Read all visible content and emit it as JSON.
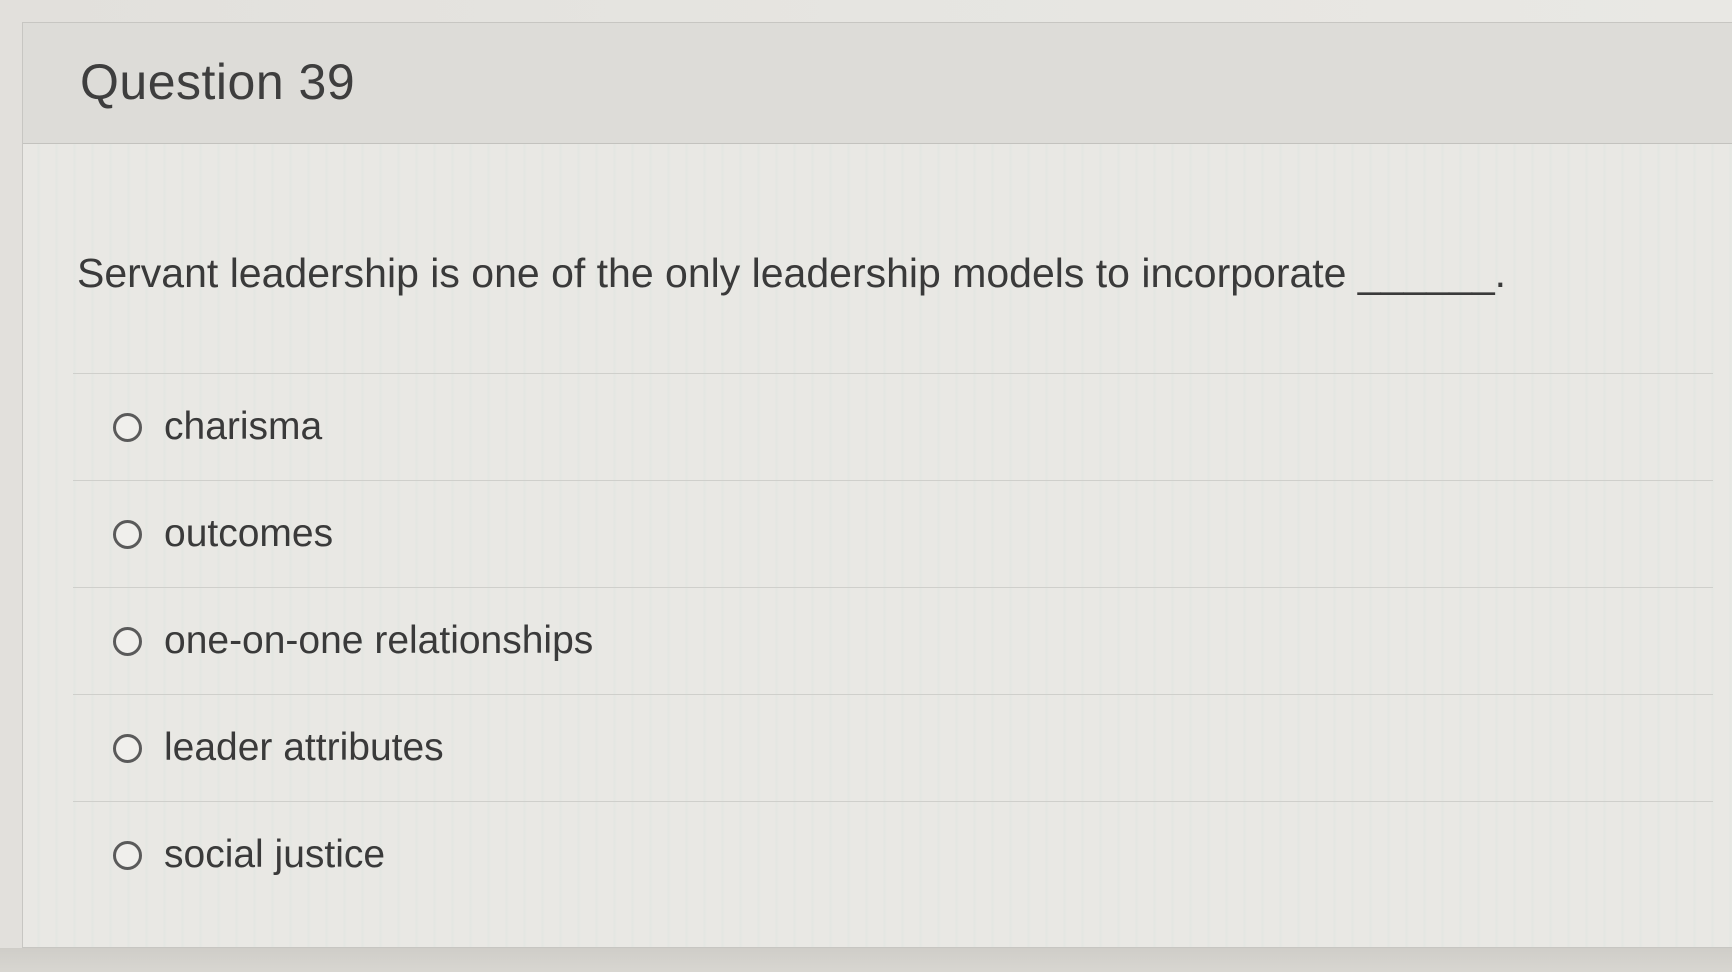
{
  "question": {
    "title": "Question 39",
    "prompt": "Servant leadership is one of the only leadership models to incorporate ______."
  },
  "answers": [
    {
      "label": "charisma",
      "selected": false
    },
    {
      "label": "outcomes",
      "selected": false
    },
    {
      "label": "one-on-one relationships",
      "selected": false
    },
    {
      "label": "leader attributes",
      "selected": false
    },
    {
      "label": "social justice",
      "selected": false
    }
  ],
  "icons": {
    "radio": "radio-unchecked-icon"
  }
}
